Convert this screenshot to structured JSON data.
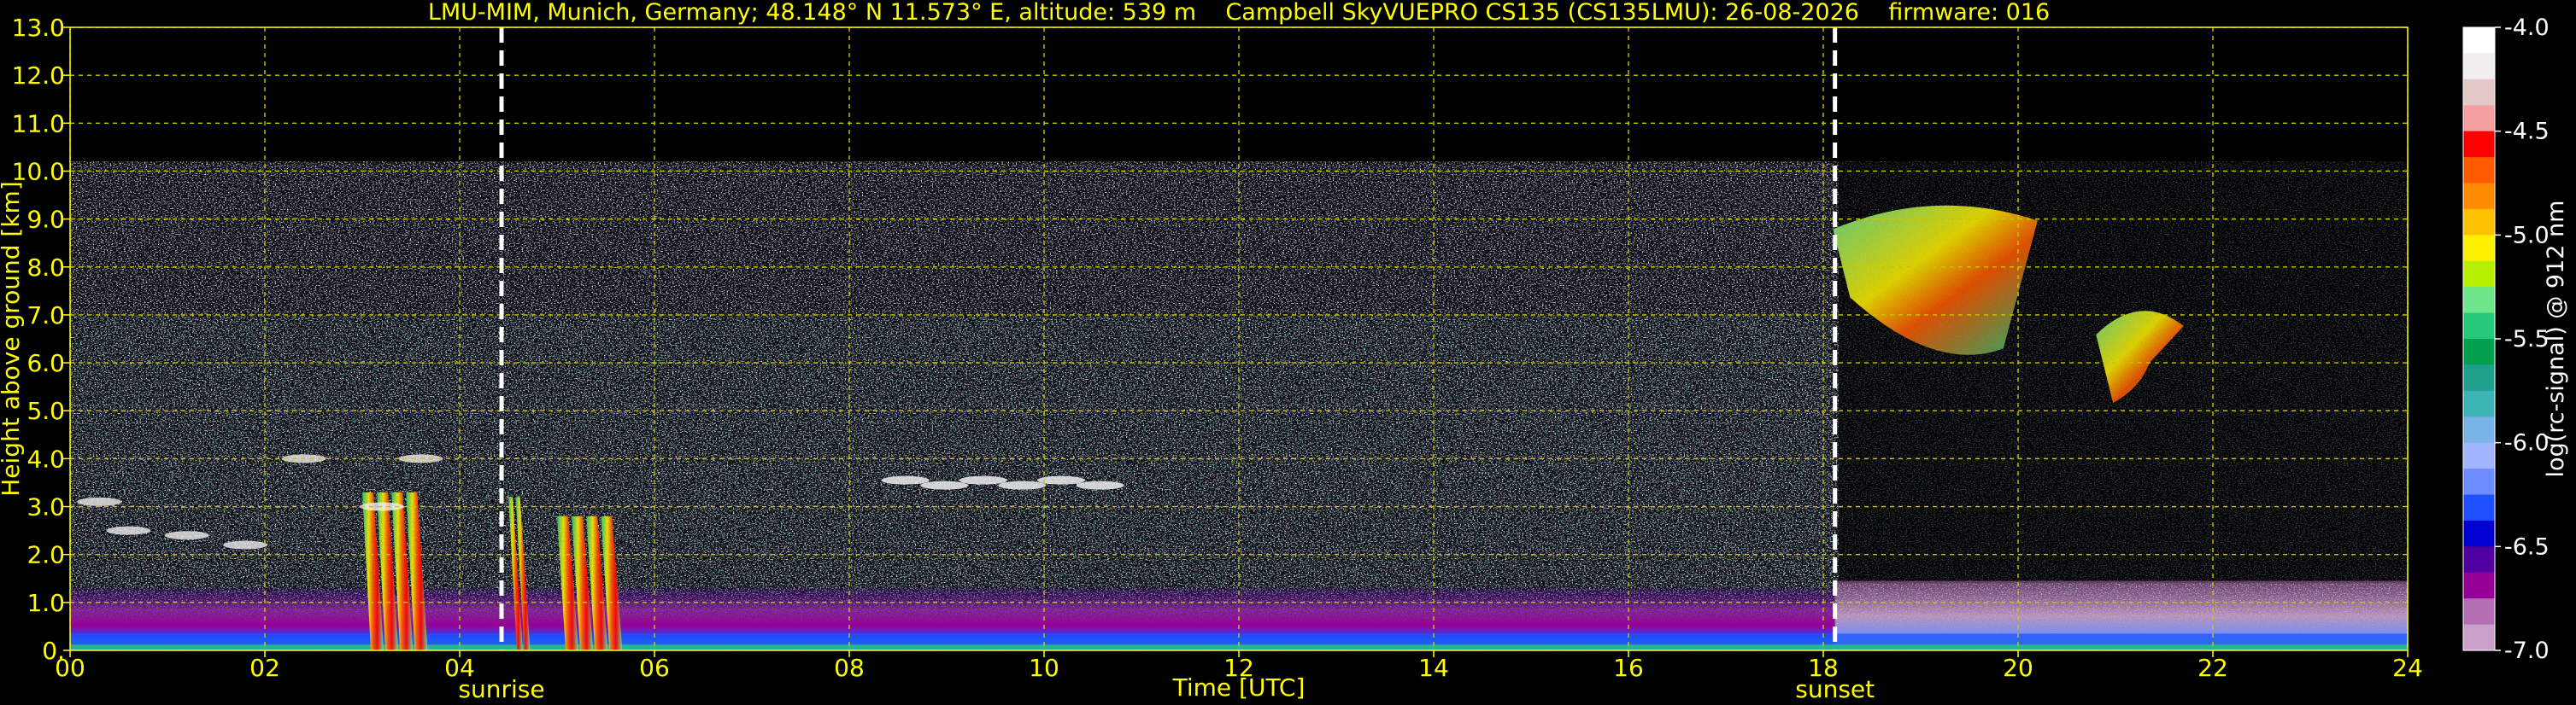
{
  "chart_data": {
    "type": "heatmap",
    "title": "LMU-MIM, Munich, Germany; 48.148° N 11.573° E, altitude: 539 m    Campbell SkyVUEPRO CS135 (CS135LMU): 26-08-2026    firmware: 016",
    "xlabel": "Time [UTC]",
    "ylabel": "Height above ground [km]",
    "xlim": [
      0,
      24
    ],
    "ylim": [
      0,
      13
    ],
    "x_ticks": [
      "00",
      "02",
      "04",
      "06",
      "08",
      "10",
      "12",
      "14",
      "16",
      "18",
      "20",
      "22",
      "24"
    ],
    "y_ticks": [
      "0.",
      "1.0",
      "2.0",
      "3.0",
      "4.0",
      "5.0",
      "6.0",
      "7.0",
      "8.0",
      "9.0",
      "10.0",
      "11.0",
      "12.0",
      "13.0"
    ],
    "grid": true,
    "colorbar": {
      "label": "log(rc-signal) @ 912 nm",
      "range": [
        -7.0,
        -4.0
      ],
      "ticks": [
        "-4.0",
        "-4.5",
        "-5.0",
        "-5.5",
        "-6.0",
        "-6.5",
        "-7.0"
      ],
      "colors": [
        "#ffffff",
        "#f0eeee",
        "#e3c8c8",
        "#f4a0a0",
        "#ff0000",
        "#ff5a00",
        "#ff8c00",
        "#ffc000",
        "#fff000",
        "#b4f000",
        "#6ee68c",
        "#28c87a",
        "#00a050",
        "#1ea08c",
        "#3cb4b4",
        "#78b4e6",
        "#a0b4ff",
        "#6e8cff",
        "#1e50ff",
        "#0000d2",
        "#5000a0",
        "#960096",
        "#b46eb4",
        "#c8a0c8"
      ]
    },
    "annotations": [
      {
        "text": "sunrise",
        "time": 4.43
      },
      {
        "text": "sunset",
        "time": 18.12
      }
    ],
    "noise_ceiling_km": 10.2,
    "features": [
      {
        "name": "boundary layer",
        "t_start": 0,
        "t_end": 24,
        "top_km": 1.3
      },
      {
        "name": "precipitation streak",
        "t_start": 3.0,
        "t_end": 3.6,
        "top_km": 3.3
      },
      {
        "name": "precipitation streak",
        "t_start": 4.5,
        "t_end": 4.65,
        "top_km": 3.2
      },
      {
        "name": "precipitation streak",
        "t_start": 5.0,
        "t_end": 5.6,
        "top_km": 2.8
      },
      {
        "name": "upper cloud",
        "t_start": 18.1,
        "t_end": 20.2,
        "top_km": 9.5
      },
      {
        "name": "upper cloud",
        "t_start": 20.8,
        "t_end": 21.7,
        "top_km": 7.3
      },
      {
        "name": "low cloud",
        "t_start": 8.4,
        "t_end": 10.8,
        "top_km": 3.8
      }
    ]
  }
}
